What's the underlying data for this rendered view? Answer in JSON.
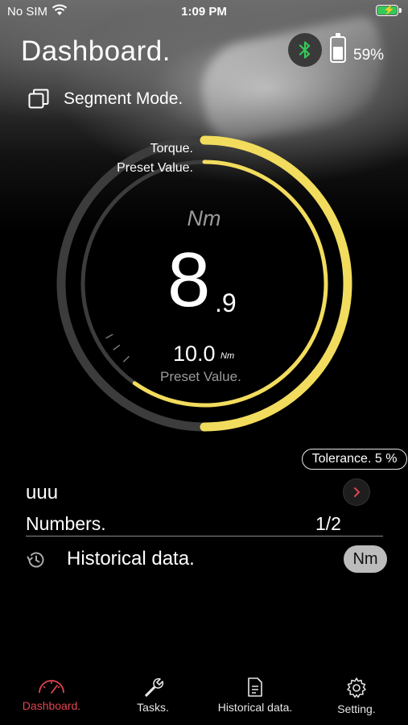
{
  "status_bar": {
    "carrier": "No SIM",
    "time": "1:09 PM"
  },
  "header": {
    "title": "Dashboard.",
    "battery_percent": "59%",
    "battery_level": 0.59
  },
  "mode": {
    "label": "Segment Mode."
  },
  "gauge": {
    "torque_label": "Torque.",
    "preset_label": "Preset Value.",
    "unit": "Nm",
    "reading_integer": "8",
    "reading_decimal": ".9",
    "reading_value": 8.9,
    "preset_value": "10.0",
    "preset_unit": "Nm",
    "preset_caption": "Preset Value.",
    "accent_color": "#f2dc5d",
    "track_color": "#3c3c3c"
  },
  "tolerance": {
    "label": "Tolerance. 5 %"
  },
  "task": {
    "name": "uuu",
    "numbers_label": "Numbers.",
    "numbers_value": "1/2"
  },
  "historical": {
    "label": "Historical data.",
    "unit_toggle": "Nm"
  },
  "tabs": [
    {
      "label": "Dashboard.",
      "icon": "speedometer-icon",
      "active": true
    },
    {
      "label": "Tasks.",
      "icon": "wrench-icon",
      "active": false
    },
    {
      "label": "Historical data.",
      "icon": "document-icon",
      "active": false
    },
    {
      "label": "Setting.",
      "icon": "gear-icon",
      "active": false
    }
  ],
  "colors": {
    "active_tab": "#e0454f",
    "bluetooth": "#35c759",
    "accent": "#f2dc5d"
  }
}
